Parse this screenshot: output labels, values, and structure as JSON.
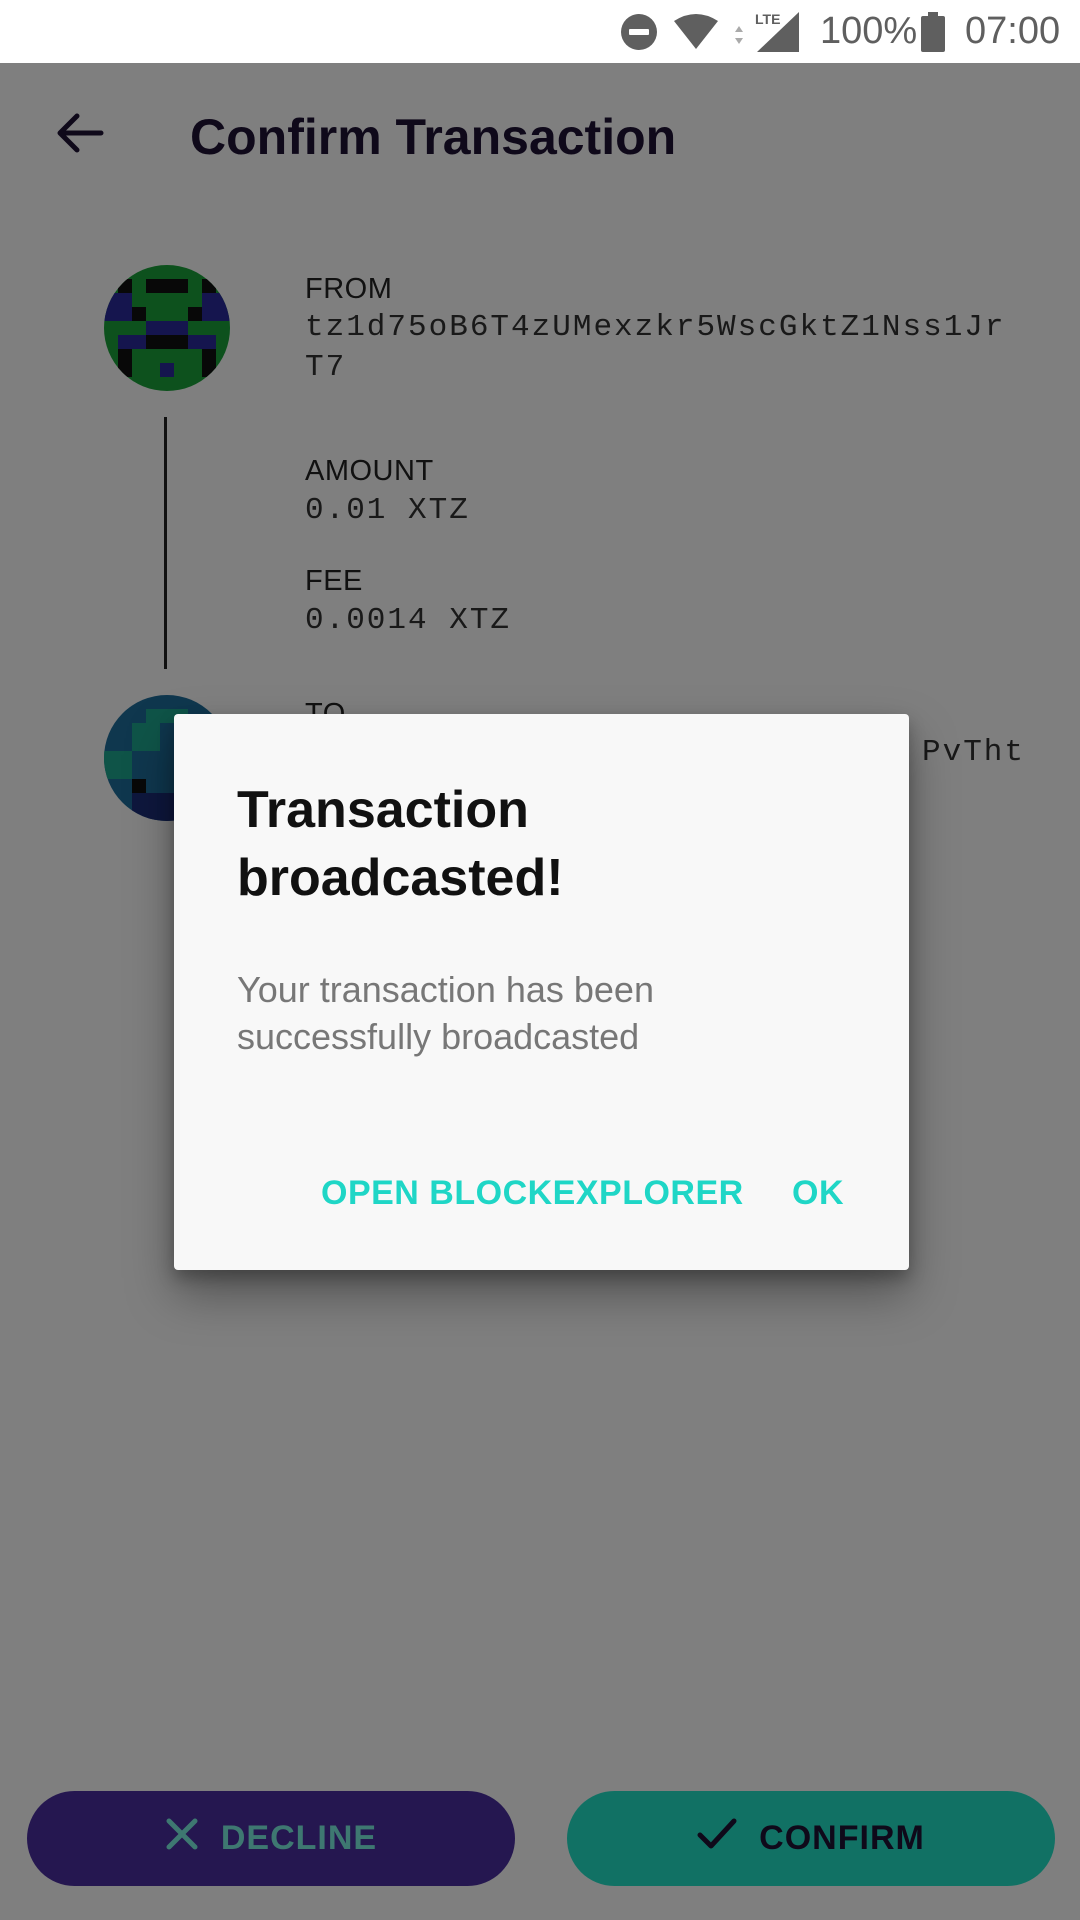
{
  "status_bar": {
    "battery_percent": "100%",
    "time": "07:00",
    "network": "LTE"
  },
  "header": {
    "title": "Confirm Transaction"
  },
  "transaction": {
    "from_label": "FROM",
    "from_address": "tz1d75oB6T4zUMexzkr5WscGktZ1Nss1JrT7",
    "amount_label": "AMOUNT",
    "amount": "0.01 XTZ",
    "fee_label": "FEE",
    "fee": "0.0014 XTZ",
    "to_label": "TO",
    "to_address_visible": "PvTht"
  },
  "actions": {
    "decline": "DECLINE",
    "confirm": "CONFIRM"
  },
  "dialog": {
    "title": "Transaction broadcasted!",
    "message": "Your transaction has been successfully broadcasted",
    "open_explorer": "OPEN BLOCKEXPLORER",
    "ok": "OK"
  },
  "colors": {
    "primary_dark": "#4a2fa0",
    "accent": "#22e2c8",
    "dialog_button": "#1fd6c6"
  }
}
